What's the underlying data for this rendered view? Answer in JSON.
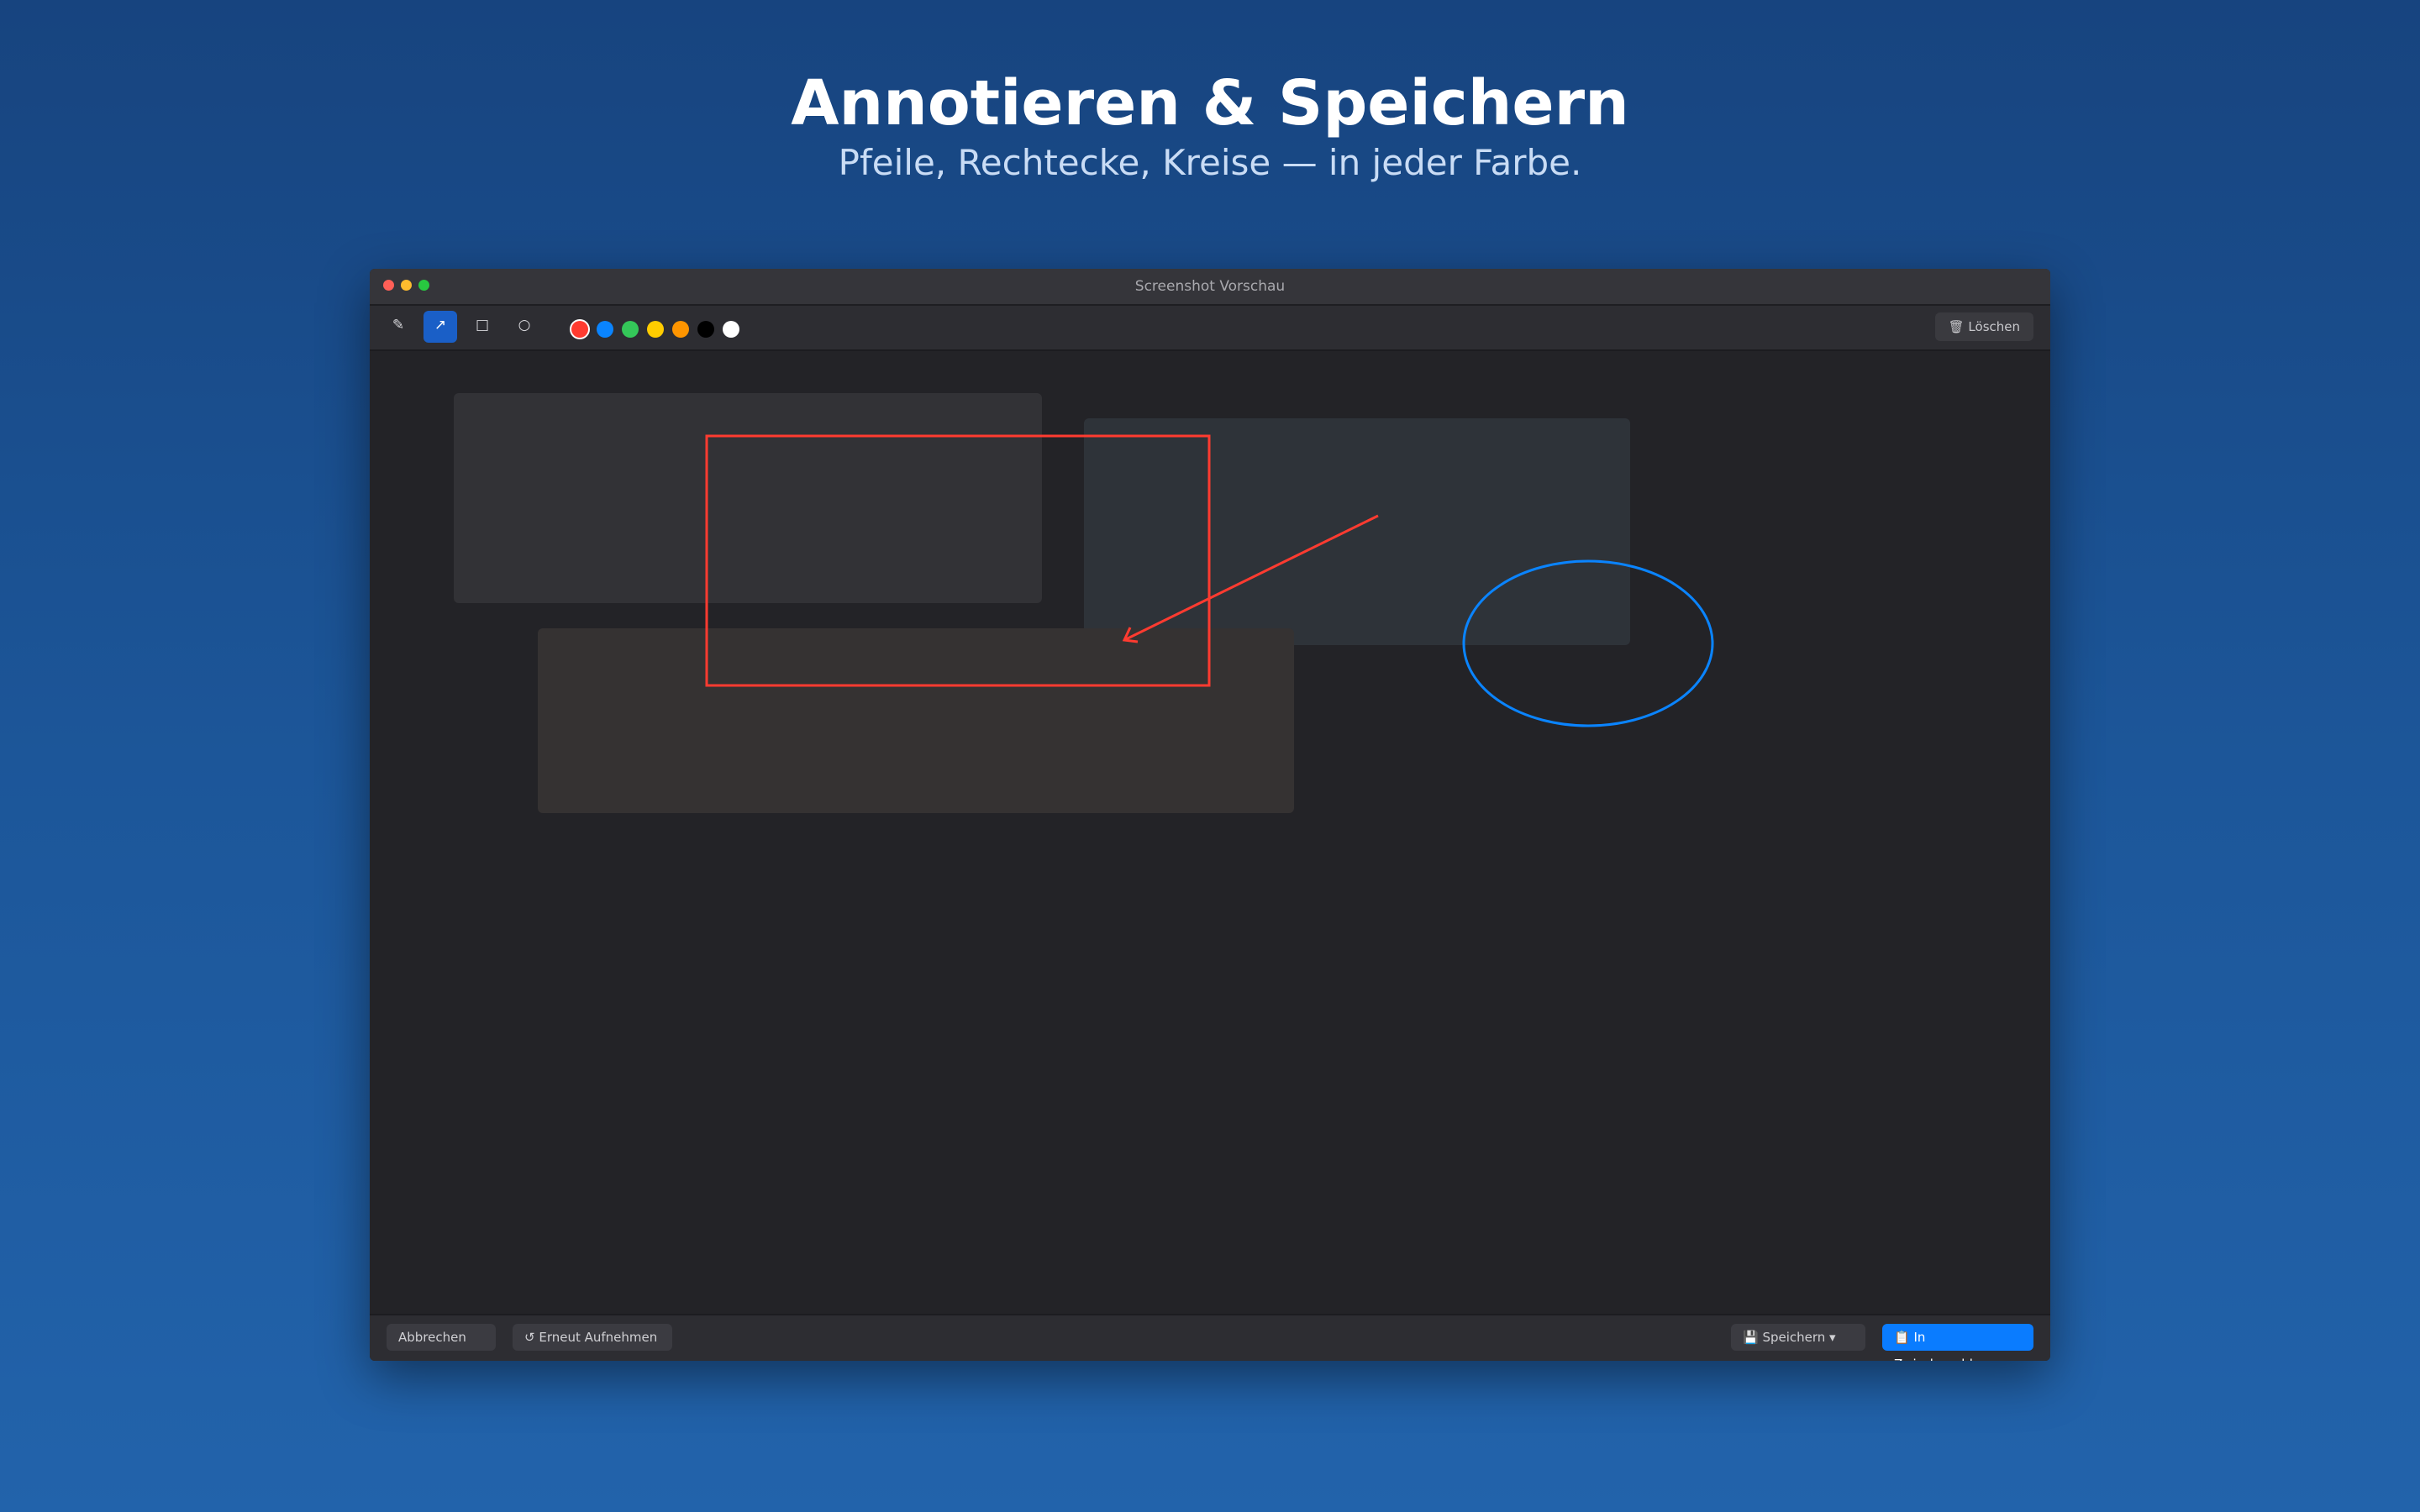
{
  "hero": {
    "title": "Annotieren & Speichern",
    "subtitle": "Pfeile, Rechtecke, Kreise — in jeder Farbe."
  },
  "window": {
    "title": "Screenshot Vorschau"
  },
  "toolbar": {
    "tools": [
      {
        "name": "pen-tool",
        "icon": "pen-icon",
        "glyph": "✎",
        "active": false
      },
      {
        "name": "arrow-tool",
        "icon": "arrow-icon",
        "glyph": "↗",
        "active": true
      },
      {
        "name": "rectangle-tool",
        "icon": "rectangle-icon",
        "glyph": "□",
        "active": false
      },
      {
        "name": "circle-tool",
        "icon": "circle-icon",
        "glyph": "○",
        "active": false
      }
    ],
    "colors": [
      "#ff3b30",
      "#0a84ff",
      "#34c759",
      "#ffcc00",
      "#ff9500",
      "#000000",
      "#ffffff"
    ],
    "selected_color": "#ff3b30",
    "delete_icon": "trash-icon",
    "delete_label": "🗑 Löschen"
  },
  "annotations": {
    "rectangle_color": "#ff3b30",
    "arrow_color": "#ff3b30",
    "ellipse_color": "#0a84ff"
  },
  "bottombar": {
    "cancel_label": "Abbrechen",
    "retake_label": "↺ Erneut Aufnehmen",
    "save_label": "💾 Speichern ▾",
    "clipboard_label": "📋 In Zwischenablage"
  },
  "colors": {
    "accent": "#0a7cff",
    "tool_active": "#1a5fc7"
  }
}
